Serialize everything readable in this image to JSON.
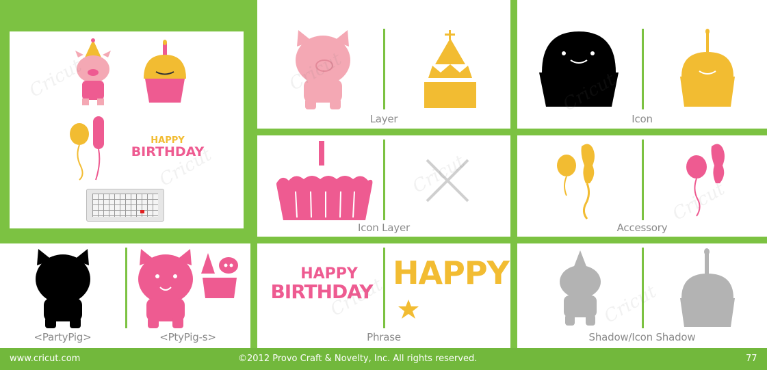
{
  "panels": {
    "layer": "Layer",
    "icon": "Icon",
    "icon_layer": "Icon Layer",
    "accessory": "Accessory",
    "party_pig": "<PartyPig>",
    "pty_pig_s": "<PtyPig-s>",
    "phrase": "Phrase",
    "shadow": "Shadow/Icon Shadow"
  },
  "overview": {
    "birthday_art_top": "HAPPY",
    "birthday_art_bottom": "BIRTHDAY"
  },
  "phrase_art": {
    "left_top": "HAPPY",
    "left_bottom": "BIRTHDAY",
    "right": "HAPPY"
  },
  "watermark": "Cricut",
  "footer": {
    "website": "www.cricut.com",
    "copyright": "©2012 Provo Craft & Novelty, Inc. All rights reserved.",
    "page_number": "77"
  },
  "colors": {
    "green": "#7cc242",
    "pink": "#ee5b91",
    "light_pink": "#f4a8b4",
    "yellow": "#f2bc32",
    "gray": "#b3b3b3",
    "black": "#000000"
  }
}
